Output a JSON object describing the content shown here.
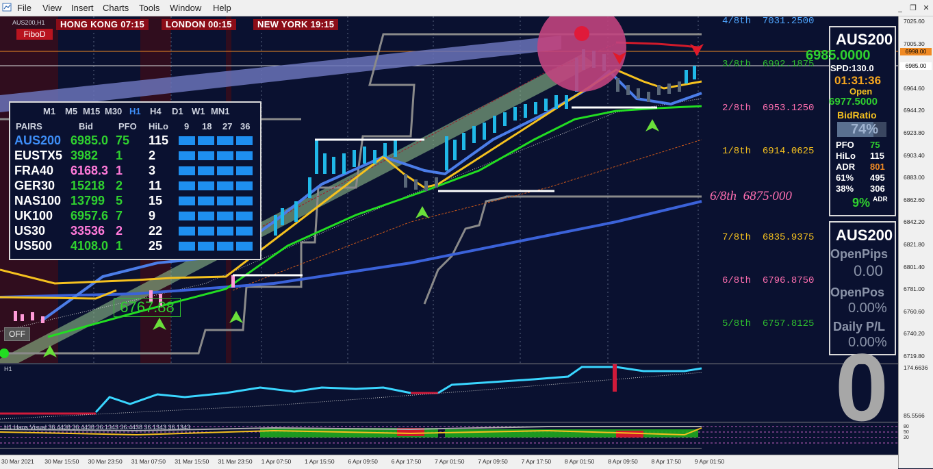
{
  "menu": [
    "File",
    "View",
    "Insert",
    "Charts",
    "Tools",
    "Window",
    "Help"
  ],
  "window_buttons": [
    "_",
    "❐",
    "✕"
  ],
  "chart": {
    "symbol_label": "AUS200,H1",
    "fibod_label": "FiboD",
    "off_label": "OFF",
    "sessions": [
      {
        "label": "HONG KONG 07:15"
      },
      {
        "label": "LONDON  00:15"
      },
      {
        "label": "NEW YORK 19:15"
      }
    ],
    "price_bubble": "6767.88"
  },
  "fib_levels": [
    {
      "name": "4/8th",
      "value": "7031.2500",
      "color": "#4fa6ff"
    },
    {
      "name": "3/8th",
      "value": "6992.1875",
      "color": "#2fbf2f"
    },
    {
      "name": "2/8th",
      "value": "6953.1250",
      "color": "#ff6fb0"
    },
    {
      "name": "1/8th",
      "value": "6914.0625",
      "color": "#f5c11f"
    },
    {
      "name": "7/8th",
      "value": "6835.9375",
      "color": "#f5c11f"
    },
    {
      "name": "6/8th",
      "value": "6796.8750",
      "color": "#ff6fb0"
    },
    {
      "name": "5/8th",
      "value": "6757.8125",
      "color": "#2fbf2f"
    }
  ],
  "fib_highlight": {
    "name": "6/8th",
    "value": "6875·000"
  },
  "axis_prices": [
    "7025.60",
    "7005.30",
    "6985.00",
    "6964.60",
    "6944.20",
    "6923.80",
    "6903.40",
    "6883.00",
    "6862.60",
    "6842.20",
    "6821.80",
    "6801.40",
    "6781.00",
    "6760.60",
    "6740.20",
    "6719.80"
  ],
  "price_tags": [
    {
      "text": "6998.00",
      "bg": "#f08a24",
      "fg": "#000"
    },
    {
      "text": "6985.00",
      "bg": "#ffffff",
      "fg": "#000"
    }
  ],
  "ind1_axis": [
    "174.6636",
    "85.5566"
  ],
  "ind2_label": "H1 Haos Visual 36.4438 36.4438 36.1343 36.4438 36.1343 36.1343",
  "ind2_axis": [
    "80",
    "50",
    "20"
  ],
  "time_labels": [
    "30 Mar 2021",
    "30 Mar 15:50",
    "30 Mar 23:50",
    "31 Mar 07:50",
    "31 Mar 15:50",
    "31 Mar 23:50",
    "1 Apr 07:50",
    "1 Apr 15:50",
    "6 Apr 09:50",
    "6 Apr 17:50",
    "7 Apr 01:50",
    "7 Apr 09:50",
    "7 Apr 17:50",
    "8 Apr 01:50",
    "8 Apr 09:50",
    "8 Apr 17:50",
    "9 Apr 01:50"
  ],
  "pairs_panel": {
    "timeframes": [
      "M1",
      "M5",
      "M15",
      "M30",
      "H1",
      "H4",
      "D1",
      "W1",
      "MN1"
    ],
    "active_timeframe": "H1",
    "headers": [
      "PAIRS",
      "Bid",
      "PFO",
      "HiLo",
      "9",
      "18",
      "27",
      "36"
    ],
    "rows": [
      {
        "pair": "AUS200",
        "bid": "6985.0",
        "pfo": "75",
        "hilo": "115",
        "pair_color": "#3e8ef7",
        "bid_color": "#2fd02f",
        "pfo_color": "#2fd02f"
      },
      {
        "pair": "EUSTX5",
        "bid": "3982",
        "pfo": "1",
        "hilo": "2",
        "pair_color": "#ffffff",
        "bid_color": "#2fd02f",
        "pfo_color": "#2fd02f"
      },
      {
        "pair": "FRA40",
        "bid": "6168.3",
        "pfo": "1",
        "hilo": "3",
        "pair_color": "#ffffff",
        "bid_color": "#ff7ad9",
        "pfo_color": "#ff7ad9"
      },
      {
        "pair": "GER30",
        "bid": "15218",
        "pfo": "2",
        "hilo": "11",
        "pair_color": "#ffffff",
        "bid_color": "#2fd02f",
        "pfo_color": "#2fd02f"
      },
      {
        "pair": "NAS100",
        "bid": "13799",
        "pfo": "5",
        "hilo": "15",
        "pair_color": "#ffffff",
        "bid_color": "#2fd02f",
        "pfo_color": "#2fd02f"
      },
      {
        "pair": "UK100",
        "bid": "6957.6",
        "pfo": "7",
        "hilo": "9",
        "pair_color": "#ffffff",
        "bid_color": "#2fd02f",
        "pfo_color": "#2fd02f"
      },
      {
        "pair": "US30",
        "bid": "33536",
        "pfo": "2",
        "hilo": "22",
        "pair_color": "#ffffff",
        "bid_color": "#ff7ad9",
        "pfo_color": "#ff7ad9"
      },
      {
        "pair": "US500",
        "bid": "4108.0",
        "pfo": "1",
        "hilo": "25",
        "pair_color": "#ffffff",
        "bid_color": "#2fd02f",
        "pfo_color": "#2fd02f"
      }
    ]
  },
  "info_panel": {
    "symbol": "AUS200",
    "price": "6985.0000",
    "spread": "SPD:130.0",
    "timer": "01:31:36",
    "open_label": "Open",
    "open_value": "6977.5000",
    "bid_ratio_label": "BidRatio",
    "bid_ratio_value": "74%",
    "bid_ratio_fill": 0.74,
    "stats": [
      {
        "label": "PFO",
        "value": "75",
        "color": "#2fd02f"
      },
      {
        "label": "HiLo",
        "value": "115",
        "color": "#ffffff"
      },
      {
        "label": "ADR",
        "value": "801",
        "color": "#f08a24"
      },
      {
        "label": "61%",
        "value": "495",
        "color": "#ffffff"
      },
      {
        "label": "38%",
        "value": "306",
        "color": "#ffffff"
      }
    ],
    "adr_percent": "9%",
    "adr_suffix": "ADR"
  },
  "pos_panel": {
    "symbol": "AUS200",
    "open_pips_label": "OpenPips",
    "open_pips_value": "0.00",
    "open_pos_label": "OpenPos",
    "open_pos_value": "0.00%",
    "daily_pl_label": "Daily P/L",
    "daily_pl_value": "0.00%"
  },
  "big_digit": "0"
}
